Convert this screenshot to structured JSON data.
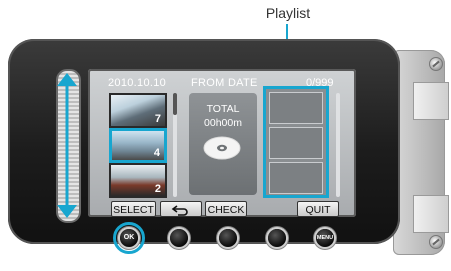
{
  "callout": {
    "label": "Playlist"
  },
  "lcd": {
    "date": "2010.10.10",
    "mode": "FROM DATE",
    "count": "0/999",
    "thumbnails": [
      {
        "number": "7"
      },
      {
        "number": "4"
      },
      {
        "number": "2"
      }
    ],
    "total_label": "TOTAL",
    "total_time": "00h00m"
  },
  "softkeys": {
    "select": "SELECT",
    "back_icon": "return-arrow-icon",
    "check": "CHECK",
    "quit": "QUIT"
  },
  "hardware_buttons": {
    "ok": "OK",
    "menu": "MENU"
  },
  "colors": {
    "highlight": "#18a6cf",
    "selected_thumb_border": "#18a6cf"
  }
}
